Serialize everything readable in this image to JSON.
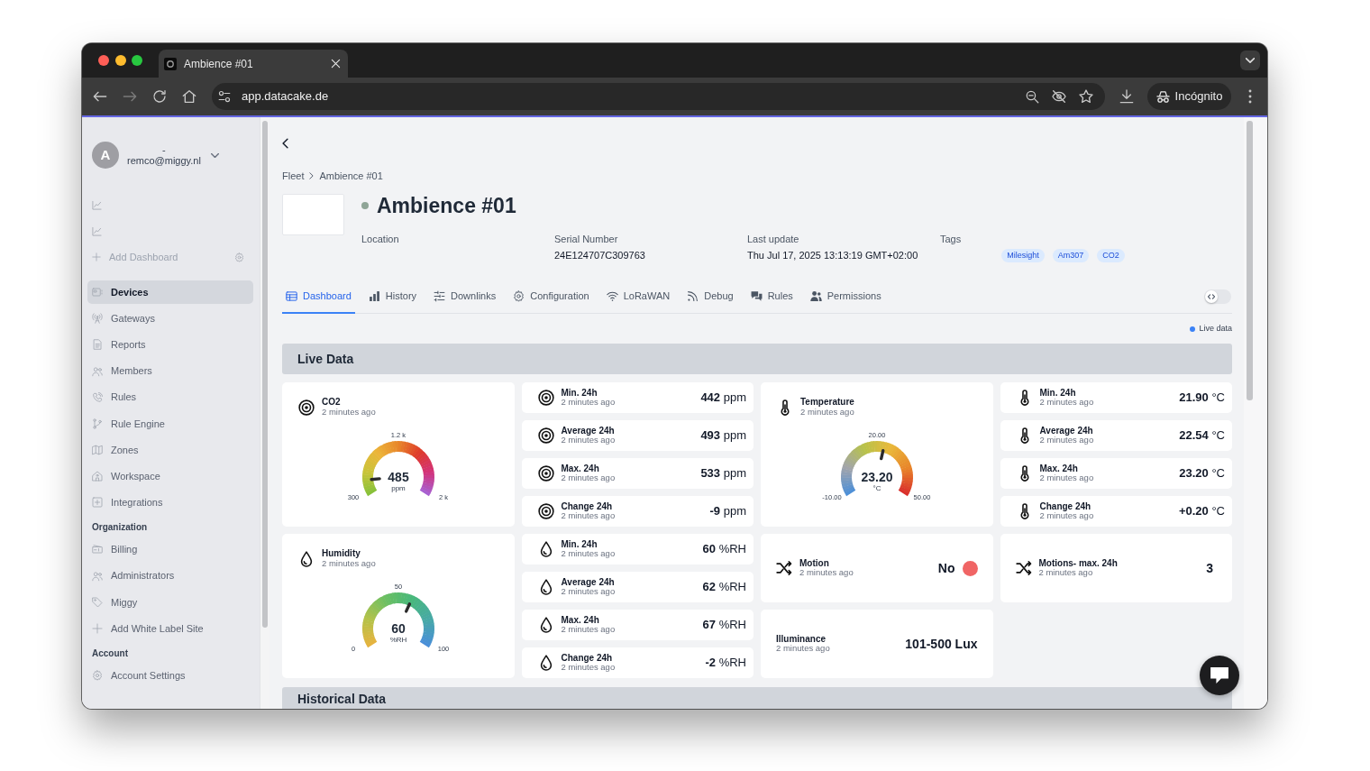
{
  "browser": {
    "tab_title": "Ambience #01",
    "url": "app.datacake.de",
    "profile": "Incógnito"
  },
  "sidebar": {
    "user": {
      "avatar_initial": "A",
      "name": "-",
      "email": "remco@miggy.nl"
    },
    "add_dashboard": "Add Dashboard",
    "items": [
      {
        "label": "Devices",
        "selected": true
      },
      {
        "label": "Gateways",
        "selected": false
      },
      {
        "label": "Reports",
        "selected": false
      },
      {
        "label": "Members",
        "selected": false
      },
      {
        "label": "Rules",
        "selected": false
      },
      {
        "label": "Rule Engine",
        "selected": false
      },
      {
        "label": "Zones",
        "selected": false
      },
      {
        "label": "Workspace",
        "selected": false
      },
      {
        "label": "Integrations",
        "selected": false
      }
    ],
    "groups": [
      {
        "title": "Organization",
        "items": [
          {
            "label": "Billing",
            "selected": false
          },
          {
            "label": "Administrators",
            "selected": false
          },
          {
            "label": "Miggy",
            "selected": false
          },
          {
            "label": "Add White Label Site",
            "selected": false
          }
        ]
      },
      {
        "title": "Account",
        "items": [
          {
            "label": "Account Settings",
            "selected": false
          }
        ]
      }
    ]
  },
  "main": {
    "breadcrumb": [
      "Fleet",
      "Ambience #01"
    ],
    "title": "Ambience #01",
    "details": [
      {
        "label": "Location"
      },
      {
        "label": "Serial Number",
        "value": "24E124707C309763"
      },
      {
        "label": "Last update",
        "value": "Thu Jul 17, 2025 13:13:19 GMT+02:00"
      },
      {
        "label": "Tags",
        "tags": [
          "Milesight",
          "Am307",
          "CO2"
        ]
      }
    ],
    "tabs": [
      {
        "label": "Dashboard",
        "selected": true
      },
      {
        "label": "History",
        "selected": false
      },
      {
        "label": "Downlinks",
        "selected": false
      },
      {
        "label": "Configuration",
        "selected": false
      },
      {
        "label": "LoRaWAN",
        "selected": false
      },
      {
        "label": "Debug",
        "selected": false
      },
      {
        "label": "Rules",
        "selected": false
      },
      {
        "label": "Permissions",
        "selected": false
      }
    ],
    "edit_mode": {
      "on": false
    },
    "live_label": "Live data",
    "live_data": {
      "title": "Live Data",
      "columns": [
        {
          "cards": [
            {
              "kind": "co2-gauge",
              "title": "CO2",
              "time": "2 minutes ago",
              "value": "485",
              "unit": "ppm",
              "min_label": "300",
              "mid_label": "1.2 k",
              "max_label": "2 k",
              "level": 0.11
            },
            {
              "kind": "humidity-gauge",
              "title": "Humidity",
              "time": "2 minutes ago",
              "value": "60",
              "unit": "%RH",
              "min_label": "0",
              "mid_label": "50",
              "max_label": "100",
              "level": 0.6
            }
          ]
        },
        {
          "cards": [
            {
              "kind": "co2-stat",
              "title": "Min. 24h",
              "time": "2 minutes ago",
              "value": "442",
              "unit": "ppm"
            },
            {
              "kind": "co2-stat",
              "title": "Average 24h",
              "time": "2 minutes ago",
              "value": "493",
              "unit": "ppm"
            },
            {
              "kind": "co2-stat",
              "title": "Max. 24h",
              "time": "2 minutes ago",
              "value": "533",
              "unit": "ppm"
            },
            {
              "kind": "co2-stat",
              "title": "Change 24h",
              "time": "2 minutes ago",
              "value": "-9",
              "unit": "ppm"
            },
            {
              "kind": "humidity-stat",
              "title": "Min. 24h",
              "time": "2 minutes ago",
              "value": "60",
              "unit": "%RH"
            },
            {
              "kind": "humidity-stat",
              "title": "Average 24h",
              "time": "2 minutes ago",
              "value": "62",
              "unit": "%RH"
            },
            {
              "kind": "humidity-stat",
              "title": "Max. 24h",
              "time": "2 minutes ago",
              "value": "67",
              "unit": "%RH"
            },
            {
              "kind": "humidity-stat",
              "title": "Change 24h",
              "time": "2 minutes ago",
              "value": "-2",
              "unit": "%RH"
            }
          ]
        },
        {
          "cards": [
            {
              "kind": "temperature-gauge",
              "title": "Temperature",
              "time": "2 minutes ago",
              "value": "23.20",
              "unit": "°C",
              "min_label": "-10.00",
              "mid_label": "20.00",
              "max_label": "50.00",
              "level": 0.553
            },
            {
              "kind": "motion-state",
              "title": "Motion",
              "time": "2 minutes ago",
              "value": "No",
              "on": false
            },
            {
              "kind": "reading",
              "title": "Illuminance",
              "time": "2 minutes ago",
              "value": "101-500 Lux"
            }
          ]
        },
        {
          "cards": [
            {
              "kind": "temperature-stat",
              "title": "Min. 24h",
              "time": "2 minutes ago",
              "value": "21.90",
              "unit": "°C"
            },
            {
              "kind": "temperature-stat",
              "title": "Average 24h",
              "time": "2 minutes ago",
              "value": "22.54",
              "unit": "°C"
            },
            {
              "kind": "temperature-stat",
              "title": "Max. 24h",
              "time": "2 minutes ago",
              "value": "23.20",
              "unit": "°C"
            },
            {
              "kind": "temperature-stat",
              "title": "Change 24h",
              "time": "2 minutes ago",
              "value": "+0.20",
              "unit": "°C"
            },
            {
              "kind": "motion-reading",
              "title": "Motions- max. 24h",
              "time": "2 minutes ago",
              "value": "3"
            }
          ]
        }
      ]
    },
    "historical_data": {
      "title": "Historical Data"
    }
  }
}
